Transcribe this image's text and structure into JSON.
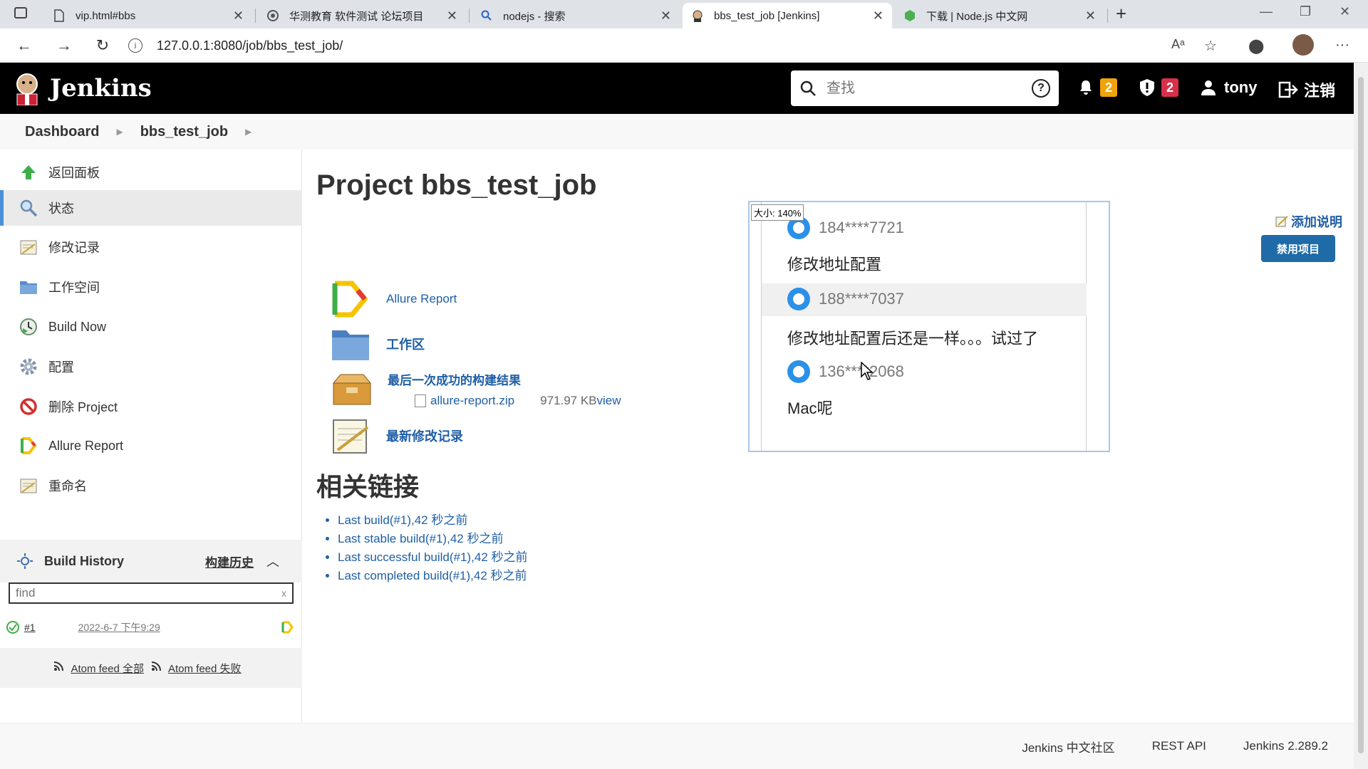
{
  "browser": {
    "tabs": [
      {
        "title": "vip.html#bbs",
        "active": false
      },
      {
        "title": "华测教育 软件测试 论坛项目",
        "active": false
      },
      {
        "title": "nodejs - 搜索",
        "active": false
      },
      {
        "title": "bbs_test_job [Jenkins]",
        "active": true
      },
      {
        "title": "下载 | Node.js 中文网",
        "active": false
      }
    ],
    "url": "127.0.0.1:8080/job/bbs_test_job/"
  },
  "header": {
    "brand": "Jenkins",
    "search_placeholder": "查找",
    "notifications_count": "2",
    "security_count": "2",
    "user": "tony",
    "logout": "注销"
  },
  "breadcrumb": [
    "Dashboard",
    "bbs_test_job"
  ],
  "sidebar": {
    "tasks": [
      {
        "label": "返回面板",
        "icon": "up-arrow-icon"
      },
      {
        "label": "状态",
        "icon": "search-icon"
      },
      {
        "label": "修改记录",
        "icon": "notepad-icon"
      },
      {
        "label": "工作空间",
        "icon": "folder-icon"
      },
      {
        "label": "Build Now",
        "icon": "clock-icon"
      },
      {
        "label": "配置",
        "icon": "gear-icon"
      },
      {
        "label": "删除 Project",
        "icon": "no-entry-icon"
      },
      {
        "label": "Allure Report",
        "icon": "allure-icon"
      },
      {
        "label": "重命名",
        "icon": "notepad-icon"
      }
    ],
    "build_history": {
      "title": "Build History",
      "trend_label": "构建历史",
      "filter_placeholder": "find",
      "filter_clear": "x",
      "builds": [
        {
          "number": "#1",
          "date": "2022-6-7 下午9:29"
        }
      ],
      "feed_all": "Atom feed 全部",
      "feed_failed": "Atom feed 失败"
    }
  },
  "main": {
    "title": "Project bbs_test_job",
    "add_description": "添加说明",
    "disable_button": "禁用项目",
    "actions": {
      "allure": "Allure Report",
      "workspace": "工作区",
      "last_success": "最后一次成功的构建结果",
      "artifact_name": "allure-report.zip",
      "artifact_size": "971.97 KB",
      "artifact_view": "view",
      "changes": "最新修改记录"
    },
    "related_title": "相关链接",
    "related_links": [
      "Last build(#1),42 秒之前",
      "Last stable build(#1),42 秒之前",
      "Last successful build(#1),42 秒之前",
      "Last completed build(#1),42 秒之前"
    ]
  },
  "overlay": {
    "zoom_label": "大小: 140%",
    "comments": [
      {
        "user": "184****7721",
        "text": "修改地址配置"
      },
      {
        "user": "188****7037",
        "text": "修改地址配置后还是一样。。。试过了"
      },
      {
        "user": "136****2068",
        "text": "Mac呢"
      }
    ]
  },
  "footer": {
    "community": "Jenkins 中文社区",
    "rest_api": "REST API",
    "version": "Jenkins 2.289.2"
  },
  "colors": {
    "header_bg": "#000000",
    "link": "#1f5fa6",
    "notify_badge": "#f0a30a",
    "security_badge": "#d9304a",
    "primary_button": "#1f6ba8"
  }
}
